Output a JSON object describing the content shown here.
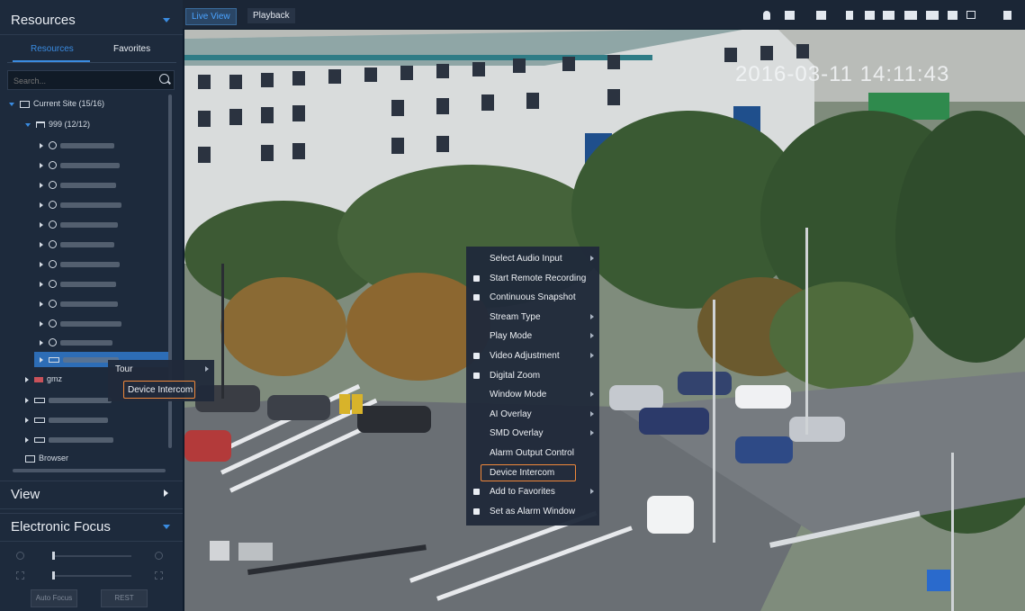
{
  "left_panel": {
    "resources_title": "Resources",
    "tabs": [
      "Resources",
      "Favorites"
    ],
    "search_placeholder": "Search...",
    "tree": {
      "current_site": "Current Site (15/16)",
      "group": "999 (12/12)",
      "gmz": "gmz",
      "browser": "Browser"
    },
    "view_title": "View",
    "ef_title": "Electronic Focus",
    "auto_focus_label": "Auto Focus",
    "rest_label": "REST"
  },
  "toolbar": {
    "live_view": "Live View",
    "playback": "Playback"
  },
  "video": {
    "timestamp": "2016-03-11 14:11:43"
  },
  "tree_context_menu": {
    "items": [
      "Tour",
      "Device Intercom"
    ]
  },
  "video_context_menu": {
    "items": [
      {
        "label": "Select Audio Input",
        "submenu": true
      },
      {
        "label": "Start Remote Recording",
        "icon": "record-icon"
      },
      {
        "label": "Continuous Snapshot",
        "icon": "snapshot-icon"
      },
      {
        "label": "Stream Type",
        "submenu": true
      },
      {
        "label": "Play Mode",
        "submenu": true
      },
      {
        "label": "Video Adjustment",
        "icon": "adjust-icon",
        "submenu": true
      },
      {
        "label": "Digital Zoom",
        "icon": "zoom-icon"
      },
      {
        "label": "Window Mode",
        "submenu": true
      },
      {
        "label": "AI Overlay",
        "submenu": true
      },
      {
        "label": "SMD Overlay",
        "submenu": true
      },
      {
        "label": "Alarm Output Control"
      },
      {
        "label": "Device Intercom",
        "highlighted": true
      },
      {
        "label": "Add to Favorites",
        "icon": "star-icon",
        "submenu": true
      },
      {
        "label": "Set as Alarm Window",
        "icon": "bell-icon"
      }
    ]
  },
  "colors": {
    "accent": "#3a8be0",
    "highlight": "#f0883a",
    "panel": "#1d2a3c"
  }
}
